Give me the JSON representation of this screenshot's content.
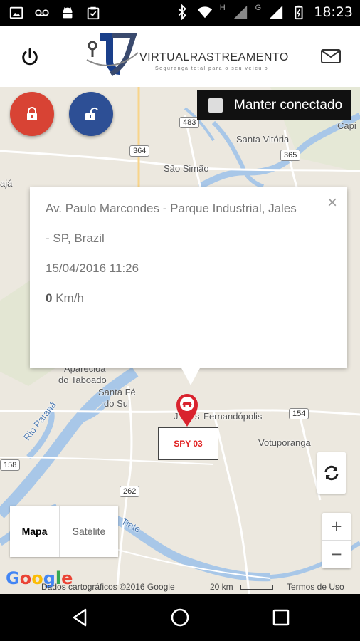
{
  "status_bar": {
    "time": "18:23",
    "network_h": "H",
    "network_g": "G",
    "icons": [
      "image-icon",
      "voicemail-icon",
      "android-icon",
      "clipboard-check-icon",
      "bluetooth-icon",
      "wifi-icon",
      "signal-icon",
      "battery-icon"
    ]
  },
  "header": {
    "logo_text": "VIRTUALRASTREAMENTO",
    "logo_tagline": "Segurança total para o seu veículo",
    "icons": [
      "power-icon",
      "mail-icon"
    ]
  },
  "controls": {
    "keep_connected_label": "Manter conectado",
    "lock_color": "#d84334",
    "unlock_color": "#2d4f95"
  },
  "popup": {
    "address_line1": "Av. Paulo Marcondes - Parque Industrial, Jales",
    "address_line2": "- SP, Brazil",
    "datetime": "15/04/2016 11:26",
    "speed_value": "0",
    "speed_unit": "Km/h",
    "close_symbol": "×"
  },
  "vehicle": {
    "label": "SPY 03",
    "marker_color": "#d9232e"
  },
  "map": {
    "places": {
      "santa_vitoria": "Santa Vitória",
      "sao_simao": "São Simão",
      "capi": "Capi",
      "aja": "ajá",
      "aparecida_1": "Aparecida",
      "aparecida_2": "do Taboado",
      "santa_fe_1": "Santa Fé",
      "santa_fe_2": "do Sul",
      "jales_j": "J",
      "jales_s": "s",
      "fernandopolis": "Fernandópolis",
      "votuporanga": "Votuporanga",
      "rio_parana": "Rio Paraná",
      "tiete": "Tiete"
    },
    "roads": {
      "r483": "483",
      "r364": "364",
      "r365": "365",
      "r154": "154",
      "r158": "158",
      "r262": "262"
    },
    "type_map": "Mapa",
    "type_satellite": "Satélite",
    "zoom_in": "+",
    "zoom_out": "−",
    "google": "Google",
    "attribution": "Dados cartográficos ©2016 Google",
    "scale": "20 km",
    "terms": "Termos de Uso"
  },
  "nav": {
    "icons": [
      "back-icon",
      "home-icon",
      "recents-icon"
    ]
  }
}
